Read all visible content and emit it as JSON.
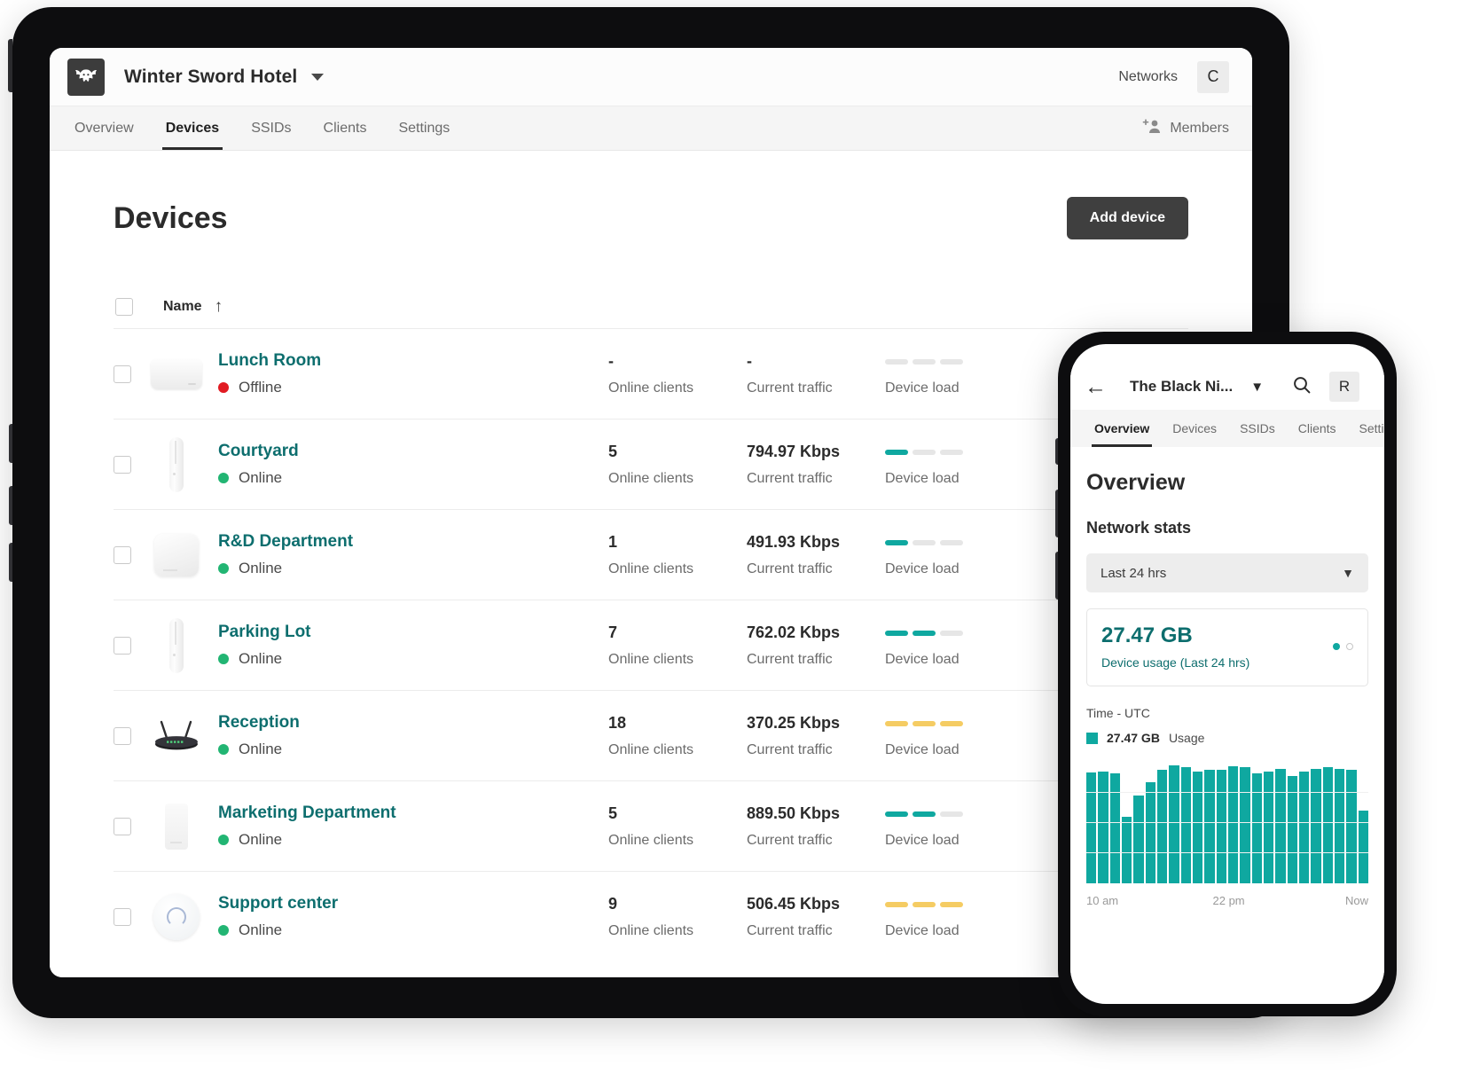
{
  "tablet": {
    "topbar": {
      "logo_icon": "bat-logo-icon",
      "network_name": "Winter Sword Hotel",
      "dropdown_icon": "caret-down-icon",
      "networks_link": "Networks",
      "avatar_initial": "C"
    },
    "tabs": [
      {
        "label": "Overview",
        "active": false
      },
      {
        "label": "Devices",
        "active": true
      },
      {
        "label": "SSIDs",
        "active": false
      },
      {
        "label": "Clients",
        "active": false
      },
      {
        "label": "Settings",
        "active": false
      }
    ],
    "members_button": {
      "label": "Members",
      "icon": "add-person-icon"
    },
    "page_title": "Devices",
    "add_device_button": "Add device",
    "table": {
      "header": {
        "name": "Name",
        "sort_icon": "sort-ascending-arrow-icon"
      },
      "column_labels": {
        "clients": "Online clients",
        "traffic": "Current traffic",
        "load": "Device load"
      },
      "rows": [
        {
          "name": "Lunch Room",
          "status": "Offline",
          "status_state": "offline",
          "thumb": "ap-box-icon",
          "clients": "-",
          "traffic": "-",
          "load_segments": [
            "off",
            "off",
            "off"
          ]
        },
        {
          "name": "Courtyard",
          "status": "Online",
          "status_state": "online",
          "thumb": "ap-stick-icon",
          "clients": "5",
          "traffic": "794.97 Kbps",
          "load_segments": [
            "teal",
            "off",
            "off"
          ]
        },
        {
          "name": "R&D Department",
          "status": "Online",
          "status_state": "online",
          "thumb": "ap-square-icon",
          "clients": "1",
          "traffic": "491.93 Kbps",
          "load_segments": [
            "teal",
            "off",
            "off"
          ]
        },
        {
          "name": "Parking Lot",
          "status": "Online",
          "status_state": "online",
          "thumb": "ap-stick-icon",
          "clients": "7",
          "traffic": "762.02 Kbps",
          "load_segments": [
            "teal",
            "teal",
            "off"
          ]
        },
        {
          "name": "Reception",
          "status": "Online",
          "status_state": "online",
          "thumb": "router-icon",
          "clients": "18",
          "traffic": "370.25 Kbps",
          "load_segments": [
            "yellow",
            "yellow",
            "yellow"
          ]
        },
        {
          "name": "Marketing Department",
          "status": "Online",
          "status_state": "online",
          "thumb": "ap-panel-icon",
          "clients": "5",
          "traffic": "889.50 Kbps",
          "load_segments": [
            "teal",
            "teal",
            "off"
          ]
        },
        {
          "name": "Support center",
          "status": "Online",
          "status_state": "online",
          "thumb": "ap-dome-icon",
          "clients": "9",
          "traffic": "506.45 Kbps",
          "load_segments": [
            "yellow",
            "yellow",
            "yellow"
          ]
        }
      ]
    }
  },
  "phone": {
    "topbar": {
      "back_icon": "arrow-left-icon",
      "title": "The Black Ni...",
      "dropdown_icon": "chevron-down-icon",
      "search_icon": "search-icon",
      "avatar_initial": "R"
    },
    "tabs": [
      {
        "label": "Overview",
        "active": true
      },
      {
        "label": "Devices",
        "active": false
      },
      {
        "label": "SSIDs",
        "active": false
      },
      {
        "label": "Clients",
        "active": false
      },
      {
        "label": "Setti",
        "active": false
      }
    ],
    "page_title": "Overview",
    "section_title": "Network stats",
    "range_select": {
      "value": "Last 24 hrs",
      "icon": "chevron-down-icon"
    },
    "usage_card": {
      "value": "27.47 GB",
      "label": "Device usage (Last 24 hrs)"
    },
    "time_label": "Time - UTC",
    "legend": {
      "value": "27.47 GB",
      "label": "Usage",
      "color": "#0fa8a0"
    }
  },
  "chart_data": {
    "type": "bar",
    "title": "Device usage (Last 24 hrs)",
    "xlabel": "Time - UTC",
    "ylabel": "",
    "series": [
      {
        "name": "27.47 GB Usage",
        "color": "#0fa8a0",
        "values": [
          92,
          93,
          91,
          55,
          73,
          84,
          94,
          98,
          96,
          93,
          94,
          94,
          97,
          96,
          91,
          93,
          95,
          89,
          93,
          95,
          96,
          95,
          94,
          60
        ]
      }
    ],
    "x_tick_labels": [
      "10 am",
      "22 pm",
      "Now"
    ],
    "ylim": [
      0,
      100
    ],
    "grid": true,
    "legend_position": "top-left"
  },
  "colors": {
    "teal": "#0d6e6e",
    "teal_bright": "#0fa8a0",
    "green": "#22b573",
    "red": "#e11b22",
    "yellow": "#f5cc63",
    "dark": "#2b2b2b"
  }
}
